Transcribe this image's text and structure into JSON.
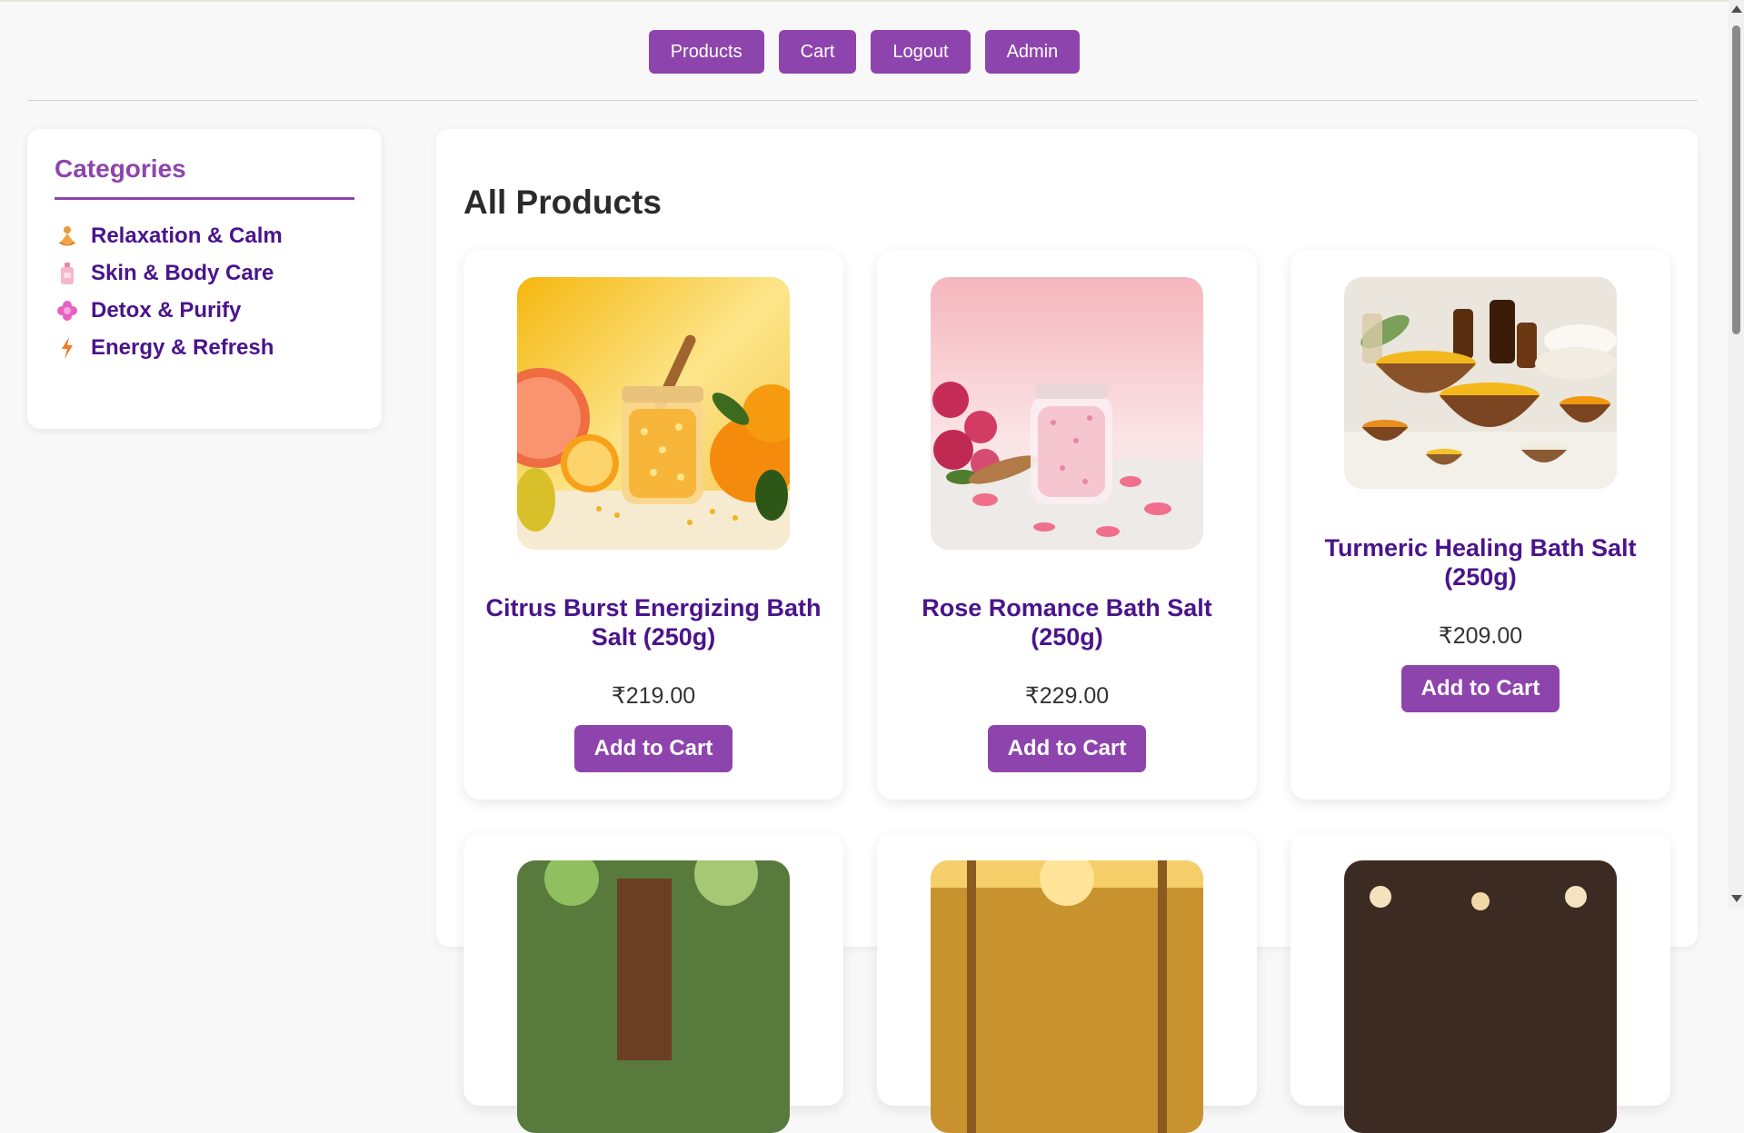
{
  "nav": {
    "items": [
      {
        "label": "Products"
      },
      {
        "label": "Cart"
      },
      {
        "label": "Logout"
      },
      {
        "label": "Admin"
      }
    ]
  },
  "sidebar": {
    "title": "Categories",
    "items": [
      {
        "label": "Relaxation & Calm",
        "icon": "meditation-icon"
      },
      {
        "label": "Skin & Body Care",
        "icon": "lotion-bottle-icon"
      },
      {
        "label": "Detox & Purify",
        "icon": "flower-icon"
      },
      {
        "label": "Energy & Refresh",
        "icon": "lightning-icon"
      }
    ]
  },
  "main": {
    "title": "All Products",
    "products": [
      {
        "name": "Citrus Burst Energizing Bath Salt (250g)",
        "price": "₹219.00",
        "button": "Add to Cart"
      },
      {
        "name": "Rose Romance Bath Salt (250g)",
        "price": "₹229.00",
        "button": "Add to Cart"
      },
      {
        "name": "Turmeric Healing Bath Salt (250g)",
        "price": "₹209.00",
        "button": "Add to Cart"
      }
    ]
  },
  "colors": {
    "accent": "#8e44ad",
    "heading_text": "#4a148c",
    "background": "#f8f8f8"
  }
}
